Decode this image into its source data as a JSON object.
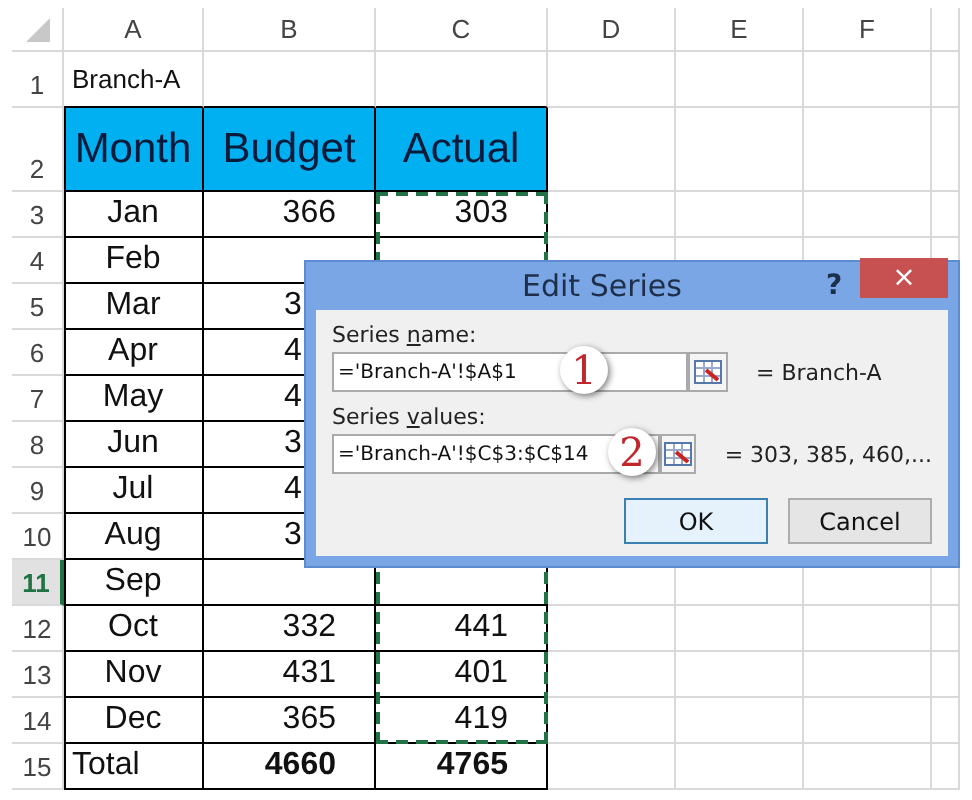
{
  "sheet": {
    "columns": [
      "A",
      "B",
      "C",
      "D",
      "E",
      "F"
    ],
    "rows": [
      {
        "number": "1",
        "selected": false,
        "kind": "title",
        "cells": [
          "Branch-A"
        ]
      },
      {
        "number": "2",
        "selected": false,
        "kind": "header",
        "cells": [
          "Month",
          "Budget",
          "Actual"
        ]
      },
      {
        "number": "3",
        "selected": false,
        "kind": "data",
        "cells": [
          "Jan",
          "366",
          "303"
        ]
      },
      {
        "number": "4",
        "selected": false,
        "kind": "data",
        "cells": [
          "Feb"
        ]
      },
      {
        "number": "5",
        "selected": false,
        "kind": "covered",
        "cells": [
          "Mar",
          "3"
        ]
      },
      {
        "number": "6",
        "selected": false,
        "kind": "covered",
        "cells": [
          "Apr",
          "4"
        ]
      },
      {
        "number": "7",
        "selected": false,
        "kind": "covered",
        "cells": [
          "May",
          "4"
        ]
      },
      {
        "number": "8",
        "selected": false,
        "kind": "covered",
        "cells": [
          "Jun",
          "3"
        ]
      },
      {
        "number": "9",
        "selected": false,
        "kind": "covered",
        "cells": [
          "Jul",
          "4"
        ]
      },
      {
        "number": "10",
        "selected": false,
        "kind": "covered",
        "cells": [
          "Aug",
          "3"
        ]
      },
      {
        "number": "11",
        "selected": true,
        "kind": "partial",
        "cells": [
          "Sep"
        ]
      },
      {
        "number": "12",
        "selected": false,
        "kind": "data",
        "cells": [
          "Oct",
          "332",
          "441"
        ]
      },
      {
        "number": "13",
        "selected": false,
        "kind": "data",
        "cells": [
          "Nov",
          "431",
          "401"
        ]
      },
      {
        "number": "14",
        "selected": false,
        "kind": "data",
        "cells": [
          "Dec",
          "365",
          "419"
        ]
      },
      {
        "number": "15",
        "selected": false,
        "kind": "total",
        "cells": [
          "Total",
          "4660",
          "4765"
        ]
      }
    ]
  },
  "dialog": {
    "title": "Edit Series",
    "help": "?",
    "close": "×",
    "fields": [
      {
        "label": {
          "before": "Series ",
          "key": "n",
          "after": "ame:"
        },
        "value": "='Branch-A'!$A$1",
        "callout": "1",
        "result": "= Branch-A"
      },
      {
        "label": {
          "before": "Series ",
          "key": "v",
          "after": "alues:"
        },
        "value": "='Branch-A'!$C$3:$C$14",
        "callout": "2",
        "result": "= 303, 385, 460,..."
      }
    ],
    "buttons": [
      {
        "label": "OK",
        "default": true
      },
      {
        "label": "Cancel",
        "default": false
      }
    ]
  }
}
